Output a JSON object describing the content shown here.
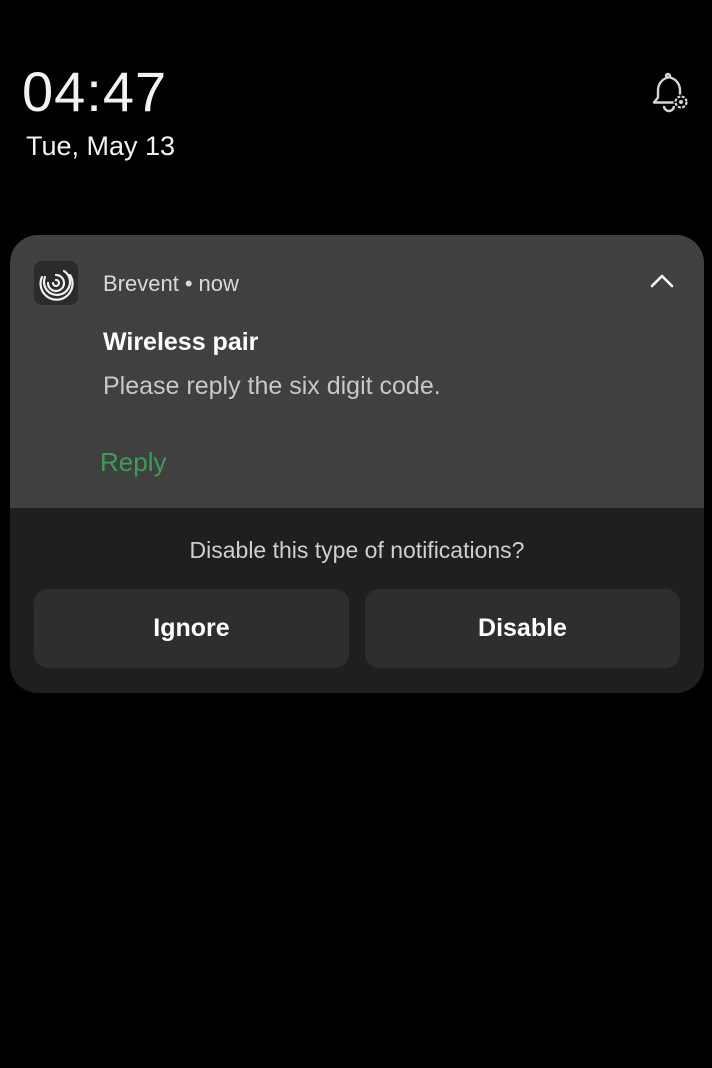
{
  "lockscreen": {
    "time": "04:47",
    "date": "Tue, May 13"
  },
  "icons": {
    "notification_settings": "bell-gear-icon",
    "app": "spiral-icon",
    "collapse": "chevron-up-icon"
  },
  "notification": {
    "app_name": "Brevent",
    "separator": "•",
    "time": "now",
    "title": "Wireless pair",
    "body": "Please reply the six digit code.",
    "action_label": "Reply"
  },
  "disable_prompt": {
    "question": "Disable this type of notifications?",
    "ignore_label": "Ignore",
    "disable_label": "Disable"
  },
  "colors": {
    "background": "#000000",
    "card_expanded": "#404040",
    "card_footer": "#1f1f1f",
    "button": "#2e2e2e",
    "accent_reply": "#3f9a57"
  }
}
